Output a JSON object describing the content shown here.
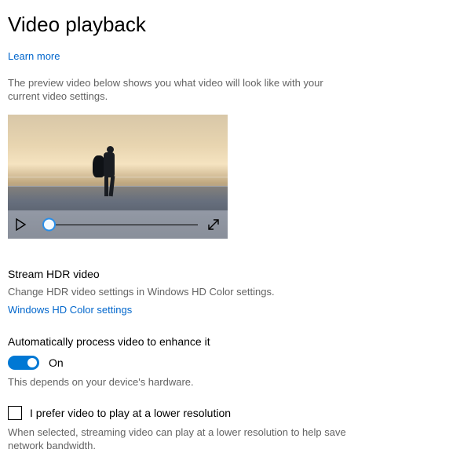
{
  "title": "Video playback",
  "learn_more": "Learn more",
  "preview_desc": "The preview video below shows you what video will look like with your current video settings.",
  "hdr": {
    "label": "Stream HDR video",
    "desc": "Change HDR video settings in Windows HD Color settings.",
    "link": "Windows HD Color settings"
  },
  "auto_enhance": {
    "label": "Automatically process video to enhance it",
    "state": "On",
    "note": "This depends on your device's hardware."
  },
  "lowres": {
    "label": "I prefer video to play at a lower resolution",
    "desc": "When selected, streaming video can play at a lower resolution to help save network bandwidth."
  }
}
